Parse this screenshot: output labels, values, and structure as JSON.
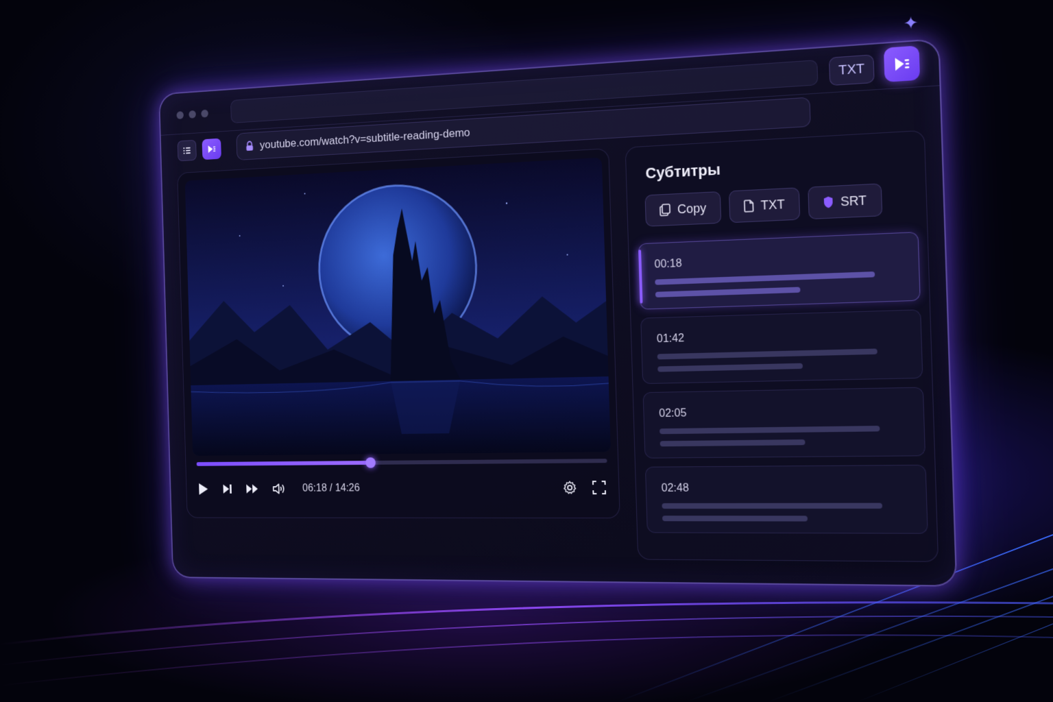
{
  "browser": {
    "url": "youtube.com/watch?v=subtitle-reading-demo",
    "top_chip_label": "TXT"
  },
  "player": {
    "time_display": "06:18 / 14:26",
    "progress": 0.44
  },
  "subtitles": {
    "title": "Субтитры",
    "actions": [
      {
        "label": "Copy",
        "icon": "copy-icon"
      },
      {
        "label": "TXT",
        "icon": "file-icon"
      },
      {
        "label": "SRT",
        "icon": "shield-icon"
      }
    ],
    "cues": [
      {
        "time": "00:18",
        "active": true
      },
      {
        "time": "01:42",
        "active": false
      },
      {
        "time": "02:05",
        "active": false
      },
      {
        "time": "02:48",
        "active": false
      }
    ]
  },
  "colors": {
    "accent": "#8b5cff",
    "background": "#03030c",
    "panel": "#0e0d22"
  }
}
